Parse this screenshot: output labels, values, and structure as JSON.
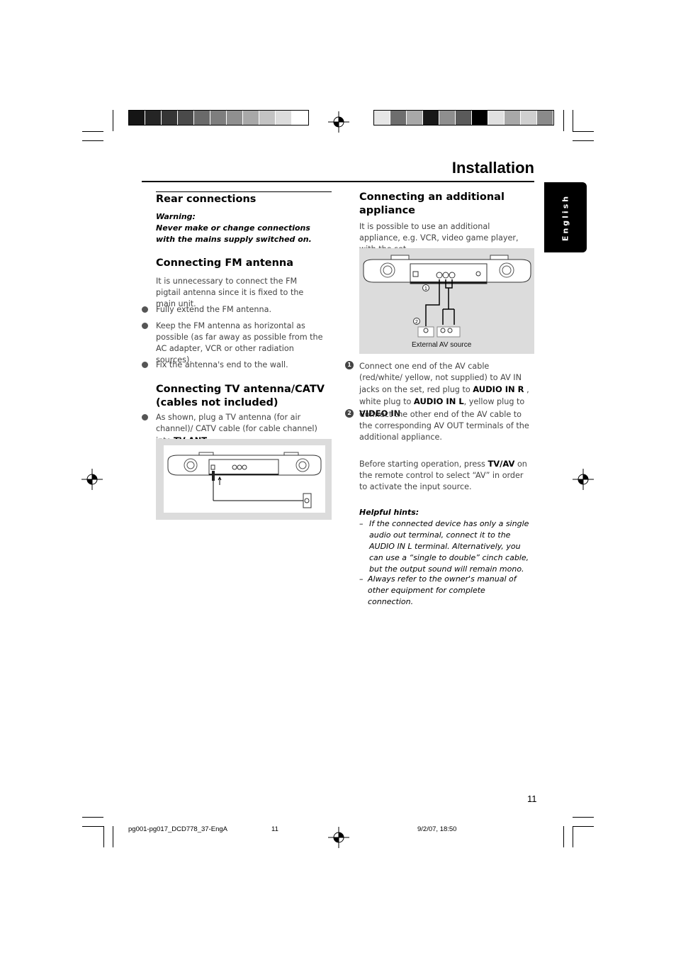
{
  "header": {
    "title": "Installation",
    "language_tab": "English",
    "left_bar_colors": [
      "#151515",
      "#252525",
      "#353535",
      "#4a4a4a",
      "#6a6a6a",
      "#7e7e7e",
      "#8f8f8f",
      "#a8a8a8",
      "#c3c3c3",
      "#dcdcdc",
      "#ffffff"
    ],
    "right_bar_colors": [
      "#e6e6e6",
      "#6e6e6e",
      "#a8a8a8",
      "#181818",
      "#8e8e8e",
      "#5a5a5a",
      "#000000",
      "#e0e0e0",
      "#a8a8a8",
      "#cfcfcf",
      "#8a8a8a"
    ]
  },
  "left": {
    "rear_title": "Rear connections",
    "warning_label": "Warning:",
    "warning_text": "Never make or change connections with the mains supply switched on.",
    "fm_title": "Connecting FM antenna",
    "fm_intro": "It is unnecessary to connect the FM pigtail antenna since it is fixed to the main unit.",
    "fm_bullets": [
      "Fully extend the FM antenna.",
      "Keep the FM antenna as horizontal as possible (as far away as possible from the AC adapter, VCR or other radiation sources).",
      "Fix the antenna's end to the wall."
    ],
    "tv_title": "Connecting TV antenna/CATV (cables not included)",
    "tv_bullet_pre": "As shown, plug a TV antenna (for air channel)/ CATV cable (for cable channel) into ",
    "tv_bullet_bold": "TV ANT",
    "tv_bullet_post": "."
  },
  "right": {
    "title": "Connecting an additional appliance",
    "intro": "It is possible to use an additional appliance, e.g. VCR, video game player, with the set.",
    "diagram_caption": "External AV source",
    "diagram_markers": [
      "1",
      "2"
    ],
    "step1": {
      "num": "1",
      "t1": "Connect one end of the AV cable (red/white/ yellow, not supplied) to AV IN jacks on the set, red plug to ",
      "b1": "AUDIO IN R",
      "t2": " , white plug to ",
      "b2": "AUDIO IN L",
      "t3": ", yellow plug to ",
      "b3": "VIDEO IN",
      "t4": "."
    },
    "step2": {
      "num": "2",
      "text": "Connect the other end of the AV cable to the corresponding AV OUT terminals of the additional appliance."
    },
    "before_pre": "Before starting operation, press ",
    "before_bold": "TV/AV",
    "before_post": " on the remote control to select “AV” in order to activate the input source.",
    "hints_label": "Helpful hints:",
    "hints": [
      "If the connected device has only a single audio out terminal, connect it to the AUDIO IN L terminal. Alternatively, you can use a “single to double” cinch cable, but the output sound will remain mono.",
      "Always refer to the owner's manual of other equipment for complete connection."
    ]
  },
  "page_number": "11",
  "footer": {
    "file": "pg001-pg017_DCD778_37-EngA",
    "page": "11",
    "date": "9/2/07, 18:50"
  }
}
